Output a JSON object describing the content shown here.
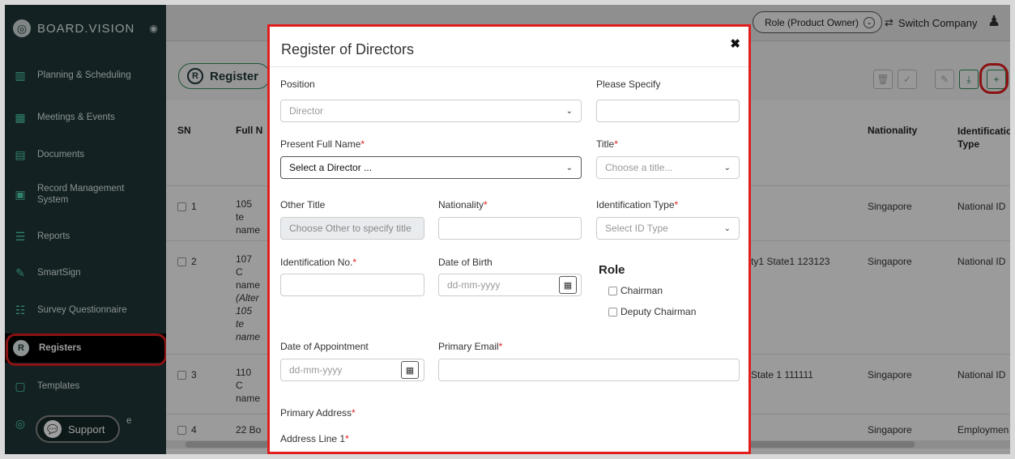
{
  "brand": {
    "name": "BOARD.VISION",
    "logo_icon": "globe-logo-icon"
  },
  "sidebar": {
    "items": [
      {
        "label": "Planning & Scheduling",
        "icon": "chart-bars-icon"
      },
      {
        "label": "Meetings & Events",
        "icon": "calendar-icon"
      },
      {
        "label": "Documents",
        "icon": "documents-icon"
      },
      {
        "label": "Record Management System",
        "icon": "record-icon"
      },
      {
        "label": "Reports",
        "icon": "reports-icon"
      },
      {
        "label": "SmartSign",
        "icon": "signature-icon"
      },
      {
        "label": "Survey Questionnaire",
        "icon": "survey-icon"
      },
      {
        "label": "Registers",
        "icon": "registers-icon"
      },
      {
        "label": "Templates",
        "icon": "templates-icon"
      },
      {
        "label": "e",
        "icon": "truncated-icon"
      }
    ],
    "support_label": "Support"
  },
  "topbar": {
    "role_label": "Role (Product Owner)",
    "switch_label": "Switch Company"
  },
  "page": {
    "register_title": "Register"
  },
  "table": {
    "headers": {
      "sn": "SN",
      "fullname": "Full N",
      "nationality": "Nationality",
      "id_type": "Identificatio Type"
    },
    "rows": [
      {
        "sn": "1",
        "name": "105 te name",
        "address": "",
        "nationality": "Singapore",
        "id_type": "National ID"
      },
      {
        "sn": "2",
        "name": "107 C name",
        "name_extra": "(Alter 105 te name",
        "address": "ty1 State1 123123",
        "nationality": "Singapore",
        "id_type": "National ID"
      },
      {
        "sn": "3",
        "name": "110 C name",
        "address": "State 1 111111",
        "nationality": "Singapore",
        "id_type": "National ID"
      },
      {
        "sn": "4",
        "name": "22 Bo",
        "address": "",
        "nationality": "Singapore",
        "id_type": "Employmen"
      }
    ]
  },
  "modal": {
    "title": "Register of Directors",
    "position": {
      "label": "Position",
      "value": "Director"
    },
    "please_specify": {
      "label": "Please Specify",
      "value": ""
    },
    "present_full_name": {
      "label": "Present Full Name",
      "value": "Select a Director ..."
    },
    "title_field": {
      "label": "Title",
      "placeholder": "Choose a title..."
    },
    "other_title": {
      "label": "Other Title",
      "placeholder": "Choose Other to specify title"
    },
    "nationality": {
      "label": "Nationality",
      "value": ""
    },
    "identification_type": {
      "label": "Identification Type",
      "placeholder": "Select ID Type"
    },
    "identification_no": {
      "label": "Identification No.",
      "value": ""
    },
    "date_of_birth": {
      "label": "Date of Birth",
      "placeholder": "dd-mm-yyyy"
    },
    "role": {
      "label": "Role",
      "options": [
        "Chairman",
        "Deputy Chairman"
      ]
    },
    "date_of_appointment": {
      "label": "Date of Appointment",
      "placeholder": "dd-mm-yyyy"
    },
    "primary_email": {
      "label": "Primary Email",
      "value": ""
    },
    "primary_address": {
      "label": "Primary Address"
    },
    "address_line_1": {
      "label": "Address Line 1"
    }
  },
  "colors": {
    "sidebar_bg": "#1f3638",
    "accent": "#2e8b57",
    "highlight": "#e01e1e"
  }
}
